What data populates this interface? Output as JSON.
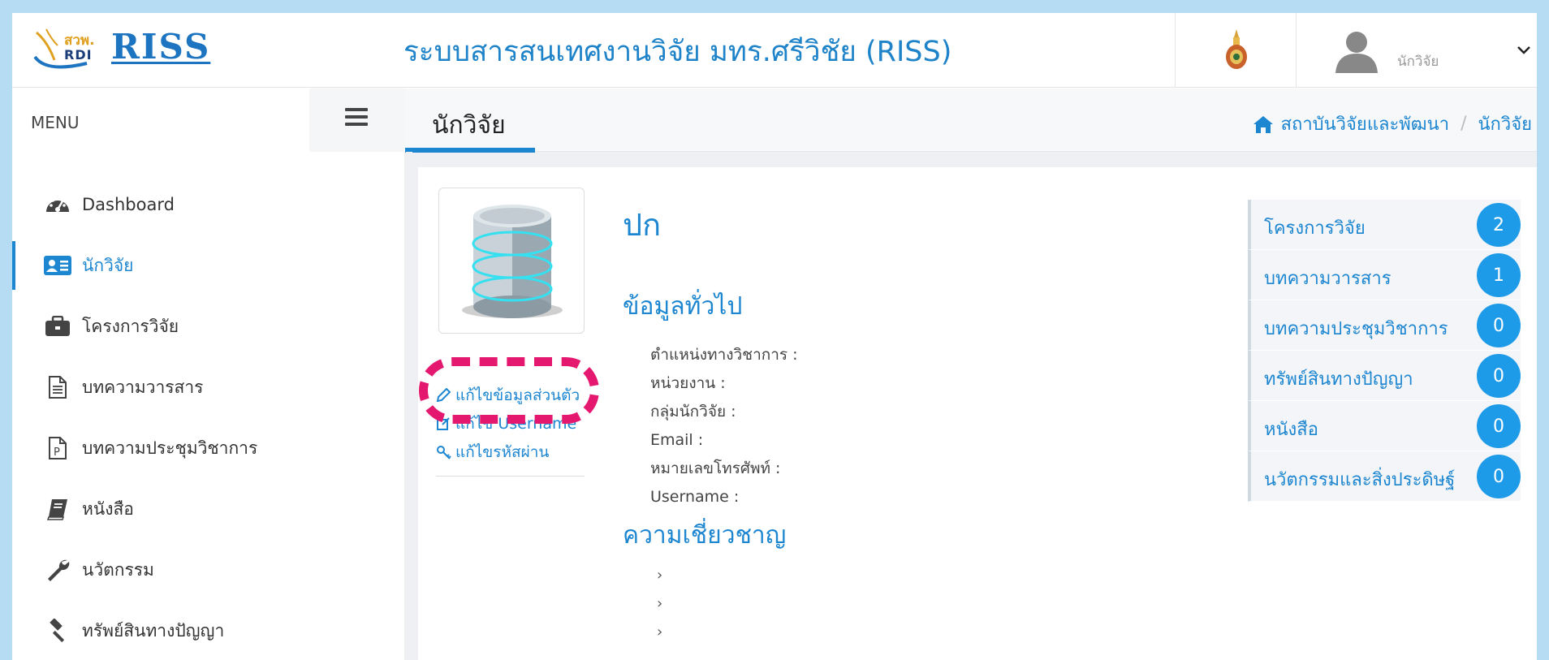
{
  "header": {
    "logo_top": "สวพ.",
    "logo_bottom": "RDI",
    "logo_main": "RISS",
    "site_title": "ระบบสารสนเทศงานวิจัย มทร.ศรีวิชัย (RISS)",
    "user_name": "นักวิจัย"
  },
  "sidebar": {
    "menu_title": "MENU",
    "items": [
      {
        "label": "Dashboard",
        "icon": "dashboard-icon"
      },
      {
        "label": "นักวิจัย",
        "icon": "id-card-icon"
      },
      {
        "label": "โครงการวิจัย",
        "icon": "briefcase-icon"
      },
      {
        "label": "บทความวารสาร",
        "icon": "document-icon"
      },
      {
        "label": "บทความประชุมวิชาการ",
        "icon": "p-document-icon"
      },
      {
        "label": "หนังสือ",
        "icon": "book-icon"
      },
      {
        "label": "นวัตกรรม",
        "icon": "wrench-icon"
      },
      {
        "label": "ทรัพย์สินทางปัญญา",
        "icon": "gavel-icon"
      }
    ]
  },
  "page": {
    "title": "นักวิจัย",
    "breadcrumb": [
      "สถาบันวิจัยและพัฒนา",
      "นักวิจัย"
    ]
  },
  "profile": {
    "name": "ปก",
    "actions": [
      "แก้ไขข้อมูลส่วนตัว",
      "แก้ไข Username",
      "แก้ไขรหัสผ่าน"
    ],
    "general_title": "ข้อมูลทั่วไป",
    "fields": [
      "ตำแหน่งทางวิชาการ :",
      "หน่วยงาน :",
      "กลุ่มนักวิจัย :",
      "Email :",
      "หมายเลขโทรศัพท์ :",
      "Username :"
    ],
    "expertise_title": "ความเชี่ยวชาญ",
    "expertise_items": [
      "›",
      "›",
      "›"
    ]
  },
  "stats": [
    {
      "label": "โครงการวิจัย",
      "count": "2"
    },
    {
      "label": "บทความวารสาร",
      "count": "1"
    },
    {
      "label": "บทความประชุมวิชาการ",
      "count": "0"
    },
    {
      "label": "ทรัพย์สินทางปัญญา",
      "count": "0"
    },
    {
      "label": "หนังสือ",
      "count": "0"
    },
    {
      "label": "นวัตกรรมและสิ่งประดิษฐ์",
      "count": "0"
    }
  ],
  "colors": {
    "accent": "#1d86d0",
    "badge": "#1e9be8",
    "highlight": "#e5186f",
    "background": "#b5dcf3"
  }
}
